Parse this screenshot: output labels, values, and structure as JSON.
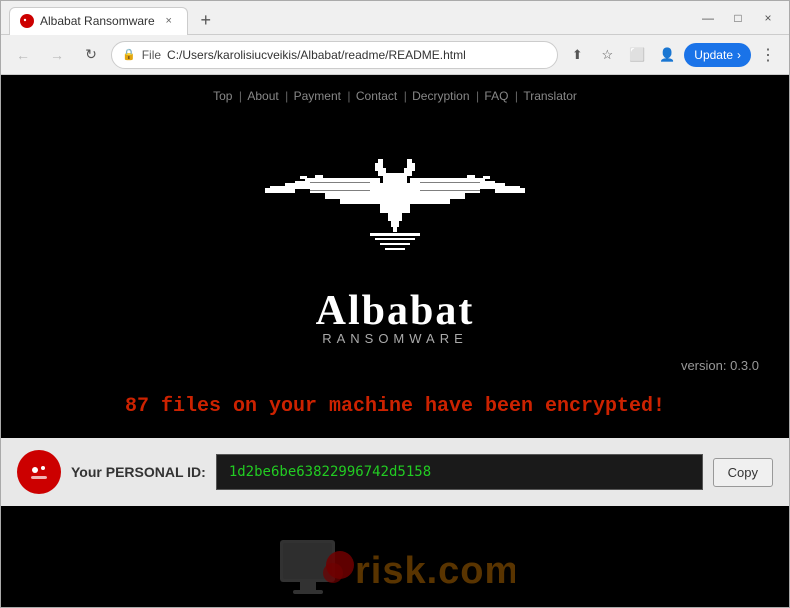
{
  "browser": {
    "tab_title": "Albabat Ransomware",
    "tab_close_label": "×",
    "new_tab_label": "+",
    "win_minimize": "—",
    "win_maximize": "□",
    "win_close": "×",
    "nav_back": "←",
    "nav_forward": "→",
    "nav_reload": "↻",
    "url_scheme": "File",
    "url_path": "C:/Users/karolisiucveikis/Albabat/readme/README.html",
    "update_label": "Update",
    "update_chevron": "›"
  },
  "page": {
    "nav_links": [
      {
        "label": "Top",
        "sep": "|"
      },
      {
        "label": "About",
        "sep": "|"
      },
      {
        "label": "Payment",
        "sep": "|"
      },
      {
        "label": "Contact",
        "sep": "|"
      },
      {
        "label": "Decryption",
        "sep": "|"
      },
      {
        "label": "FAQ",
        "sep": "|"
      },
      {
        "label": "Translator",
        "sep": ""
      }
    ],
    "brand_name": "Albabat",
    "brand_sub": "RANSOMWARE",
    "version": "version: 0.3.0",
    "encrypted_message": "87 files on your machine have been encrypted!",
    "personal_id_label": "Your PERSONAL ID:",
    "personal_id_value": "1d2be6be63822996742d5158",
    "copy_button": "Copy"
  }
}
